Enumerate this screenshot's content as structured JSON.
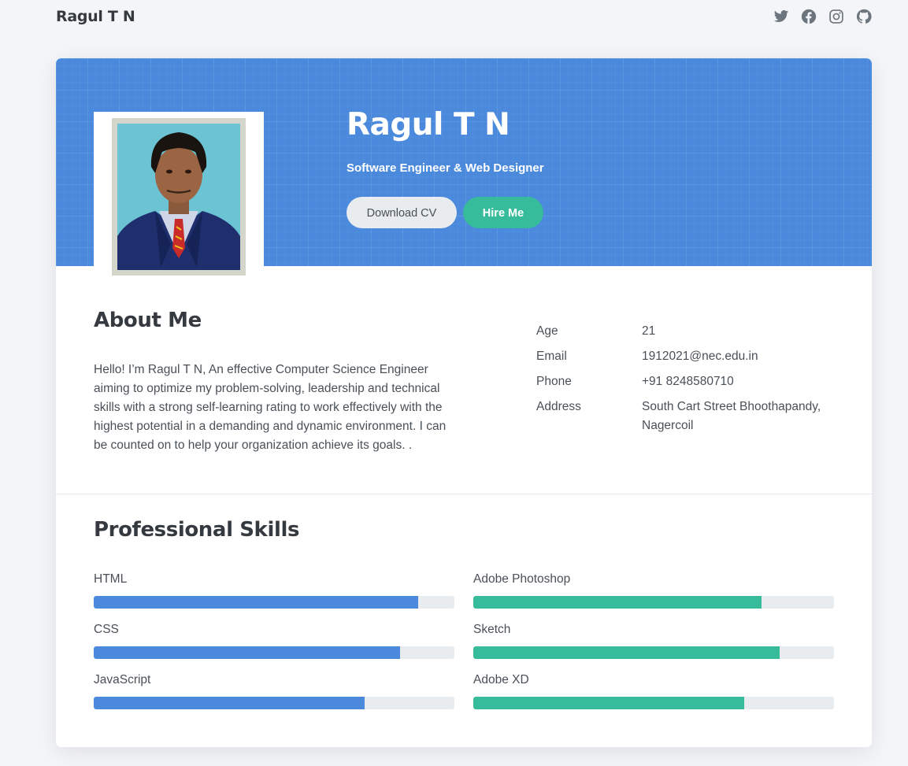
{
  "header": {
    "brand": "Ragul T N",
    "social_icons": [
      "twitter-icon",
      "facebook-icon",
      "instagram-icon",
      "github-icon"
    ]
  },
  "profile": {
    "name": "Ragul T N",
    "title": "Software Engineer & Web Designer",
    "download_label": "Download CV",
    "hire_label": "Hire Me"
  },
  "about": {
    "heading": "About Me",
    "text": "Hello! I’m Ragul T N, An effective Computer Science Engineer aiming to optimize my problem-solving, leadership and technical skills with a strong self-learning rating to work effectively with the highest potential in a demanding and dynamic environment. I can be counted on to help your organization achieve its goals. ."
  },
  "info": [
    {
      "label": "Age",
      "value": "21"
    },
    {
      "label": "Email",
      "value": "1912021@nec.edu.in"
    },
    {
      "label": "Phone",
      "value": "+91 8248580710"
    },
    {
      "label": "Address",
      "value": "South Cart Street Bhoothapandy, Nagercoil"
    }
  ],
  "skills": {
    "heading": "Professional Skills",
    "left": [
      {
        "name": "HTML",
        "level": 0.9
      },
      {
        "name": "CSS",
        "level": 0.85
      },
      {
        "name": "JavaScript",
        "level": 0.75
      }
    ],
    "right": [
      {
        "name": "Adobe Photoshop",
        "level": 0.8
      },
      {
        "name": "Sketch",
        "level": 0.85
      },
      {
        "name": "Adobe XD",
        "level": 0.75
      }
    ]
  },
  "colors": {
    "primary": "#4a89dc",
    "accent": "#37bc9b",
    "track": "#e9ecef"
  }
}
